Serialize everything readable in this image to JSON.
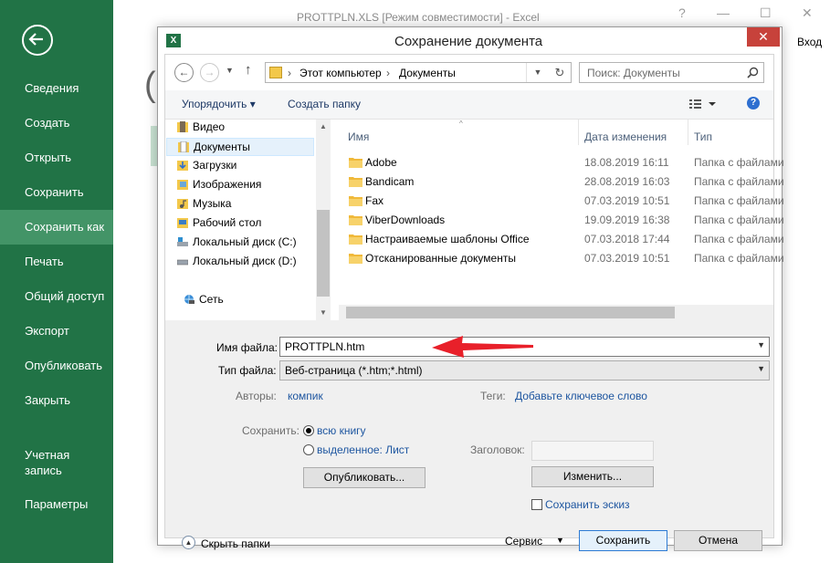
{
  "app": {
    "title": "PROTTPLN.XLS  [Режим совместимости] - Excel",
    "sign_in": "Вход",
    "window_controls": [
      "?",
      "—",
      "☐",
      "✕"
    ]
  },
  "backstage": {
    "items": [
      {
        "label": "Сведения"
      },
      {
        "label": "Создать"
      },
      {
        "label": "Открыть"
      },
      {
        "label": "Сохранить"
      },
      {
        "label": "Сохранить как",
        "active": true
      },
      {
        "label": "Печать"
      },
      {
        "label": "Общий доступ"
      },
      {
        "label": "Экспорт"
      },
      {
        "label": "Опубликовать"
      },
      {
        "label": "Закрыть"
      }
    ],
    "account": {
      "line1": "Учетная",
      "line2": "запись"
    },
    "options": "Параметры"
  },
  "dialog": {
    "title": "Сохранение документа",
    "icon_label": "X",
    "close": "✕",
    "address": {
      "part1": "Этот компьютер",
      "part2": "Документы",
      "sep": "›"
    },
    "search_placeholder": "Поиск: Документы",
    "toolbar": {
      "organize": "Упорядочить ▾",
      "new_folder": "Создать папку"
    },
    "tree": [
      {
        "label": "Видео"
      },
      {
        "label": "Документы",
        "selected": true
      },
      {
        "label": "Загрузки"
      },
      {
        "label": "Изображения"
      },
      {
        "label": "Музыка"
      },
      {
        "label": "Рабочий стол"
      },
      {
        "label": "Локальный диск (C:)"
      },
      {
        "label": "Локальный диск (D:)"
      },
      {
        "label": "Сеть"
      }
    ],
    "columns": {
      "name": "Имя",
      "date": "Дата изменения",
      "type": "Тип"
    },
    "files": [
      {
        "name": "Adobe",
        "date": "18.08.2019 16:11",
        "type": "Папка с файлами"
      },
      {
        "name": "Bandicam",
        "date": "28.08.2019 16:03",
        "type": "Папка с файлами"
      },
      {
        "name": "Fax",
        "date": "07.03.2019 10:51",
        "type": "Папка с файлами"
      },
      {
        "name": "ViberDownloads",
        "date": "19.09.2019 16:38",
        "type": "Папка с файлами"
      },
      {
        "name": "Настраиваемые шаблоны Office",
        "date": "07.03.2018 17:44",
        "type": "Папка с файлами"
      },
      {
        "name": "Отсканированные документы",
        "date": "07.03.2019 10:51",
        "type": "Папка с файлами"
      }
    ],
    "file_name_label": "Имя файла:",
    "file_name_value": "PROTTPLN.htm",
    "file_type_label": "Тип файла:",
    "file_type_value": "Веб-страница (*.htm;*.html)",
    "authors_label": "Авторы:",
    "authors_value": "компик",
    "tags_label": "Теги:",
    "tags_value": "Добавьте ключевое слово",
    "save_label": "Сохранить:",
    "radio_workbook": "всю книгу",
    "radio_selection": "выделенное: Лист",
    "heading_label": "Заголовок:",
    "change_button": "Изменить...",
    "publish_button": "Опубликовать...",
    "thumbnail_label": "Сохранить эскиз",
    "hide_folders": "Скрыть папки",
    "service": "Сервис",
    "save_button": "Сохранить",
    "cancel_button": "Отмена"
  },
  "colors": {
    "excel_green": "#217346",
    "active_item": "#439467",
    "link_blue": "#1e56a0",
    "arrow_red": "#e8202a"
  }
}
